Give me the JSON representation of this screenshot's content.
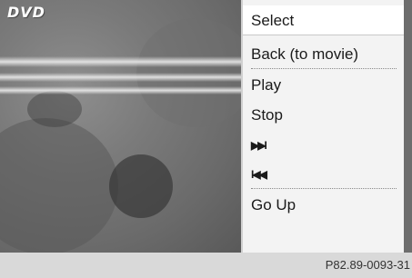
{
  "screen": {
    "source_label": "DVD"
  },
  "menu": {
    "items": [
      {
        "label": "Select"
      },
      {
        "label": "Back (to movie)"
      },
      {
        "label": "Play"
      },
      {
        "label": "Stop"
      },
      {
        "label": "▶▶I",
        "icon": "skip-forward-icon"
      },
      {
        "label": "I◀◀",
        "icon": "skip-back-icon"
      },
      {
        "label": "Go Up"
      }
    ]
  },
  "footer": {
    "code": "P82.89-0093-31"
  }
}
